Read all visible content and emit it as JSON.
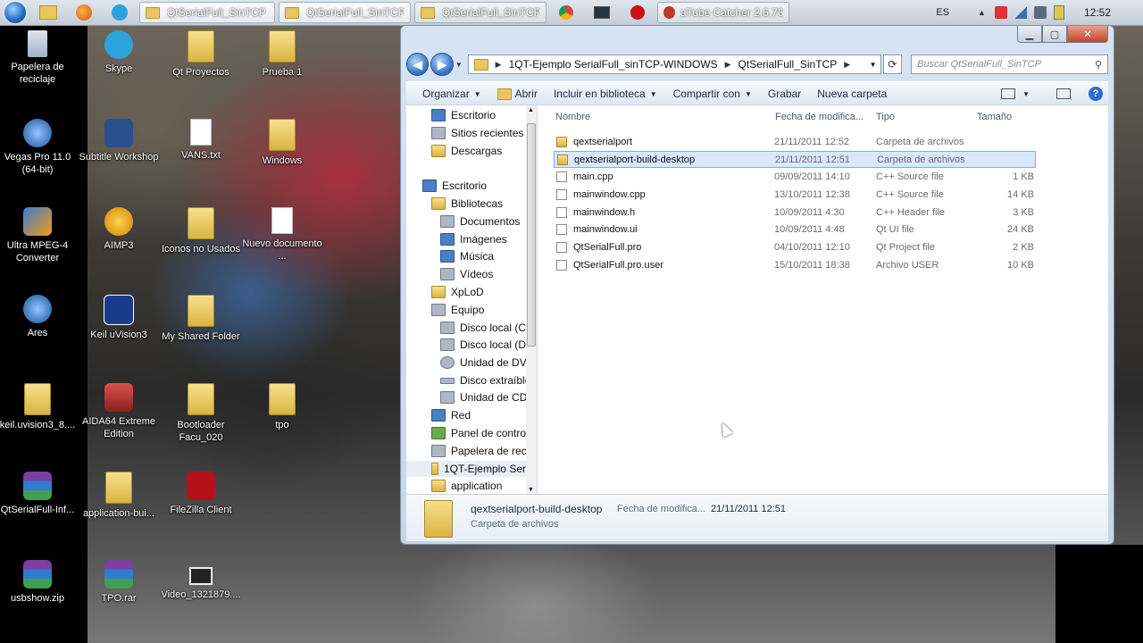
{
  "taskbar": {
    "buttons": [
      {
        "label": "QtSerialFull_SinTCP"
      },
      {
        "label": "QtSerialFull_SinTCP"
      },
      {
        "label": "QtSerialFull_SinTCP"
      },
      {
        "label": "aTube Catcher 2.6.76..."
      }
    ],
    "language": "ES",
    "clock": "12:52"
  },
  "desktop": {
    "icons": [
      {
        "label": "Papelera de reciclaje"
      },
      {
        "label": "Skype"
      },
      {
        "label": "Qt Proyectos"
      },
      {
        "label": "Prueba 1"
      },
      {
        "label": "Vegas Pro 11.0 (64-bit)"
      },
      {
        "label": "Subtitle Workshop"
      },
      {
        "label": "VANS.txt"
      },
      {
        "label": "Windows"
      },
      {
        "label": "Ultra MPEG-4 Converter"
      },
      {
        "label": "AIMP3"
      },
      {
        "label": "Iconos no Usados"
      },
      {
        "label": "Nuevo documento ..."
      },
      {
        "label": "Ares"
      },
      {
        "label": "Keil uVision3"
      },
      {
        "label": "My Shared Folder"
      },
      {
        "label": "keil.uvision3_8...."
      },
      {
        "label": "AIDA64 Extreme Edition"
      },
      {
        "label": "Bootloader Facu_020"
      },
      {
        "label": "tpo"
      },
      {
        "label": "QtSerialFull-Inf..."
      },
      {
        "label": "application-bui..."
      },
      {
        "label": "FileZilla Client"
      },
      {
        "label": "usbshow.zip"
      },
      {
        "label": "TPO.rar"
      },
      {
        "label": "Video_1321879...."
      }
    ]
  },
  "explorer": {
    "address": [
      "1QT-Ejemplo SerialFull_sinTCP-WINDOWS",
      "QtSerialFull_SinTCP"
    ],
    "search_placeholder": "Buscar QtSerialFull_SinTCP",
    "commands": [
      "Organizar",
      "Abrir",
      "Incluir en biblioteca",
      "Compartir con",
      "Grabar",
      "Nueva carpeta"
    ],
    "nav": [
      {
        "label": "Escritorio"
      },
      {
        "label": "Sitios recientes"
      },
      {
        "label": "Descargas"
      },
      {
        "label": "Escritorio"
      },
      {
        "label": "Bibliotecas"
      },
      {
        "label": "Documentos"
      },
      {
        "label": "Imágenes"
      },
      {
        "label": "Música"
      },
      {
        "label": "Vídeos"
      },
      {
        "label": "XpLoD"
      },
      {
        "label": "Equipo"
      },
      {
        "label": "Disco local (C:)"
      },
      {
        "label": "Disco local (D:)"
      },
      {
        "label": "Unidad de DVD"
      },
      {
        "label": "Disco extraíble"
      },
      {
        "label": "Unidad de CD ("
      },
      {
        "label": "Red"
      },
      {
        "label": "Panel de control"
      },
      {
        "label": "Papelera de recic"
      },
      {
        "label": "1QT-Ejemplo Ser"
      },
      {
        "label": "application"
      }
    ],
    "columns": {
      "name": "Nombre",
      "date": "Fecha de modifica...",
      "type": "Tipo",
      "size": "Tamaño"
    },
    "files": [
      {
        "name": "qextserialport",
        "date": "21/11/2011 12:52",
        "type": "Carpeta de archivos",
        "size": ""
      },
      {
        "name": "qextserialport-build-desktop",
        "date": "21/11/2011 12:51",
        "type": "Carpeta de archivos",
        "size": ""
      },
      {
        "name": "main.cpp",
        "date": "09/09/2011 14:10",
        "type": "C++ Source file",
        "size": "1 KB"
      },
      {
        "name": "mainwindow.cpp",
        "date": "13/10/2011 12:38",
        "type": "C++ Source file",
        "size": "14 KB"
      },
      {
        "name": "mainwindow.h",
        "date": "10/09/2011 4:30",
        "type": "C++ Header file",
        "size": "3 KB"
      },
      {
        "name": "mainwindow.ui",
        "date": "10/09/2011 4:48",
        "type": "Qt UI file",
        "size": "24 KB"
      },
      {
        "name": "QtSerialFull.pro",
        "date": "04/10/2011 12:10",
        "type": "Qt Project file",
        "size": "2 KB"
      },
      {
        "name": "QtSerialFull.pro.user",
        "date": "15/10/2011 18:38",
        "type": "Archivo USER",
        "size": "10 KB"
      }
    ],
    "details": {
      "name": "qextserialport-build-desktop",
      "date_label": "Fecha de modifica...",
      "date": "21/11/2011 12:51",
      "type": "Carpeta de archivos"
    }
  }
}
